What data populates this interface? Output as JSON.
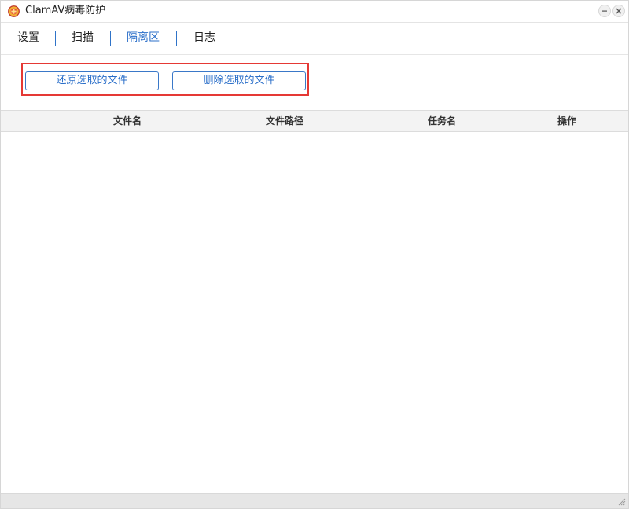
{
  "window": {
    "title": "ClamAV病毒防护",
    "icon": "shield-logo-icon",
    "controls": {
      "minimize_icon": "minimize-icon",
      "close_icon": "close-icon"
    }
  },
  "tabs": [
    {
      "label": "设置",
      "active": false
    },
    {
      "label": "扫描",
      "active": false
    },
    {
      "label": "隔离区",
      "active": true
    },
    {
      "label": "日志",
      "active": false
    }
  ],
  "toolbar": {
    "restore_label": "还原选取的文件",
    "delete_label": "删除选取的文件"
  },
  "table": {
    "columns": [
      "文件名",
      "文件路径",
      "任务名",
      "操作"
    ],
    "rows": []
  },
  "colors": {
    "accent": "#2b6fc9",
    "highlight": "#e53935",
    "header_bg": "#f3f3f3",
    "statusbar_bg": "#e6e6e6"
  }
}
